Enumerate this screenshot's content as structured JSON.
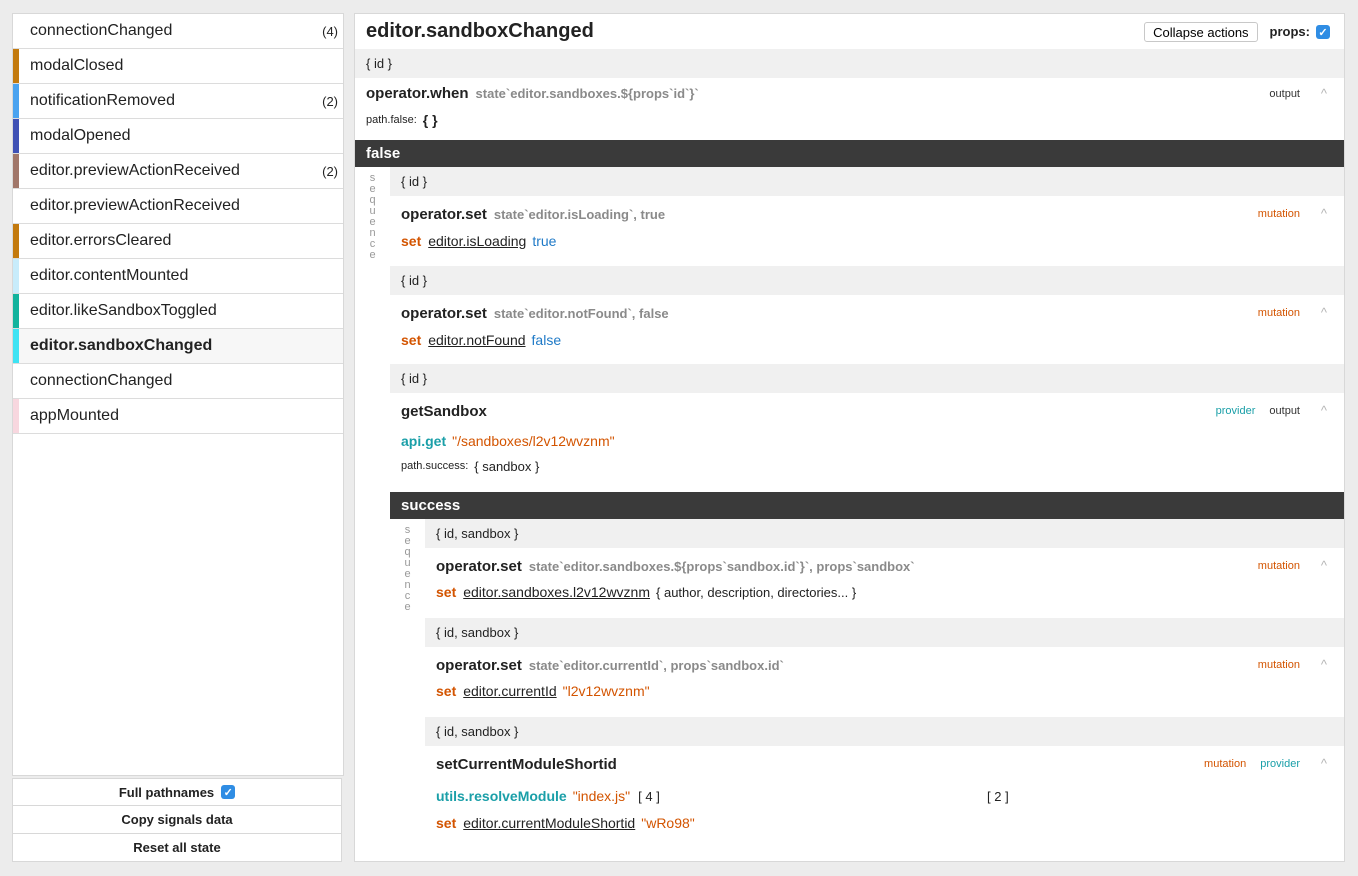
{
  "sidebar": {
    "signals": [
      {
        "name": "connectionChanged",
        "count": "(4)",
        "color": ""
      },
      {
        "name": "modalClosed",
        "count": "",
        "color": "#c37a0e"
      },
      {
        "name": "notificationRemoved",
        "count": "(2)",
        "color": "#4aa3f0"
      },
      {
        "name": "modalOpened",
        "count": "",
        "color": "#3f51b5"
      },
      {
        "name": "editor.previewActionReceived",
        "count": "(2)",
        "color": "#a1776a"
      },
      {
        "name": "editor.previewActionReceived",
        "count": "",
        "color": ""
      },
      {
        "name": "editor.errorsCleared",
        "count": "",
        "color": "#c37a0e"
      },
      {
        "name": "editor.contentMounted",
        "count": "",
        "color": "#c8ecfb"
      },
      {
        "name": "editor.likeSandboxToggled",
        "count": "",
        "color": "#12b39d"
      },
      {
        "name": "editor.sandboxChanged",
        "count": "",
        "color": "#3ee3f3",
        "selected": true
      },
      {
        "name": "connectionChanged",
        "count": "",
        "color": ""
      },
      {
        "name": "appMounted",
        "count": "",
        "color": "#f8d7df"
      }
    ],
    "footer": {
      "full_pathnames": "Full pathnames",
      "full_pathnames_checked": "✓",
      "copy_signals": "Copy signals data",
      "reset_state": "Reset all state"
    }
  },
  "main": {
    "title": "editor.sandboxChanged",
    "collapse_label": "Collapse actions",
    "props_label": "props:",
    "props_checked": "✓",
    "chevron": "^",
    "seq_letters": [
      "s",
      "e",
      "q",
      "u",
      "e",
      "n",
      "c",
      "e"
    ],
    "root": {
      "props": "{ id }",
      "action": {
        "name": "operator.when",
        "args": "state`editor.sandboxes.${props`id`}`",
        "tag_output": "output",
        "path_label": "path.false:",
        "path_value": "{ }"
      },
      "path_false": "false"
    },
    "false_seq": {
      "a1": {
        "props": "{ id }",
        "name": "operator.set",
        "args": "state`editor.isLoading`, true",
        "tag": "mutation",
        "set": "set",
        "path": "editor.isLoading",
        "value": "true"
      },
      "a2": {
        "props": "{ id }",
        "name": "operator.set",
        "args": "state`editor.notFound`, false",
        "tag": "mutation",
        "set": "set",
        "path": "editor.notFound",
        "value": "false"
      },
      "a3": {
        "props": "{ id }",
        "name": "getSandbox",
        "tag_provider": "provider",
        "tag_output": "output",
        "call": "api.get",
        "call_arg": "\"/sandboxes/l2v12wvznm\"",
        "path_label": "path.success:",
        "path_value": "{ sandbox }"
      },
      "path_success": "success"
    },
    "success_seq": {
      "b1": {
        "props": "{ id, sandbox }",
        "name": "operator.set",
        "args": "state`editor.sandboxes.${props`sandbox.id`}`, props`sandbox`",
        "tag": "mutation",
        "set": "set",
        "path": "editor.sandboxes.l2v12wvznm",
        "value": "{ author, description, directories... }"
      },
      "b2": {
        "props": "{ id, sandbox }",
        "name": "operator.set",
        "args": "state`editor.currentId`, props`sandbox.id`",
        "tag": "mutation",
        "set": "set",
        "path": "editor.currentId",
        "value": "\"l2v12wvznm\""
      },
      "b3": {
        "props": "{ id, sandbox }",
        "name": "setCurrentModuleShortid",
        "tag_mutation": "mutation",
        "tag_provider": "provider",
        "call": "utils.resolveModule",
        "call_arg": "\"index.js\"",
        "call_extra1": "[ 4 ]",
        "call_extra2": "[ 2 ]",
        "set": "set",
        "path": "editor.currentModuleShortid",
        "value": "\"wRo98\""
      }
    }
  }
}
